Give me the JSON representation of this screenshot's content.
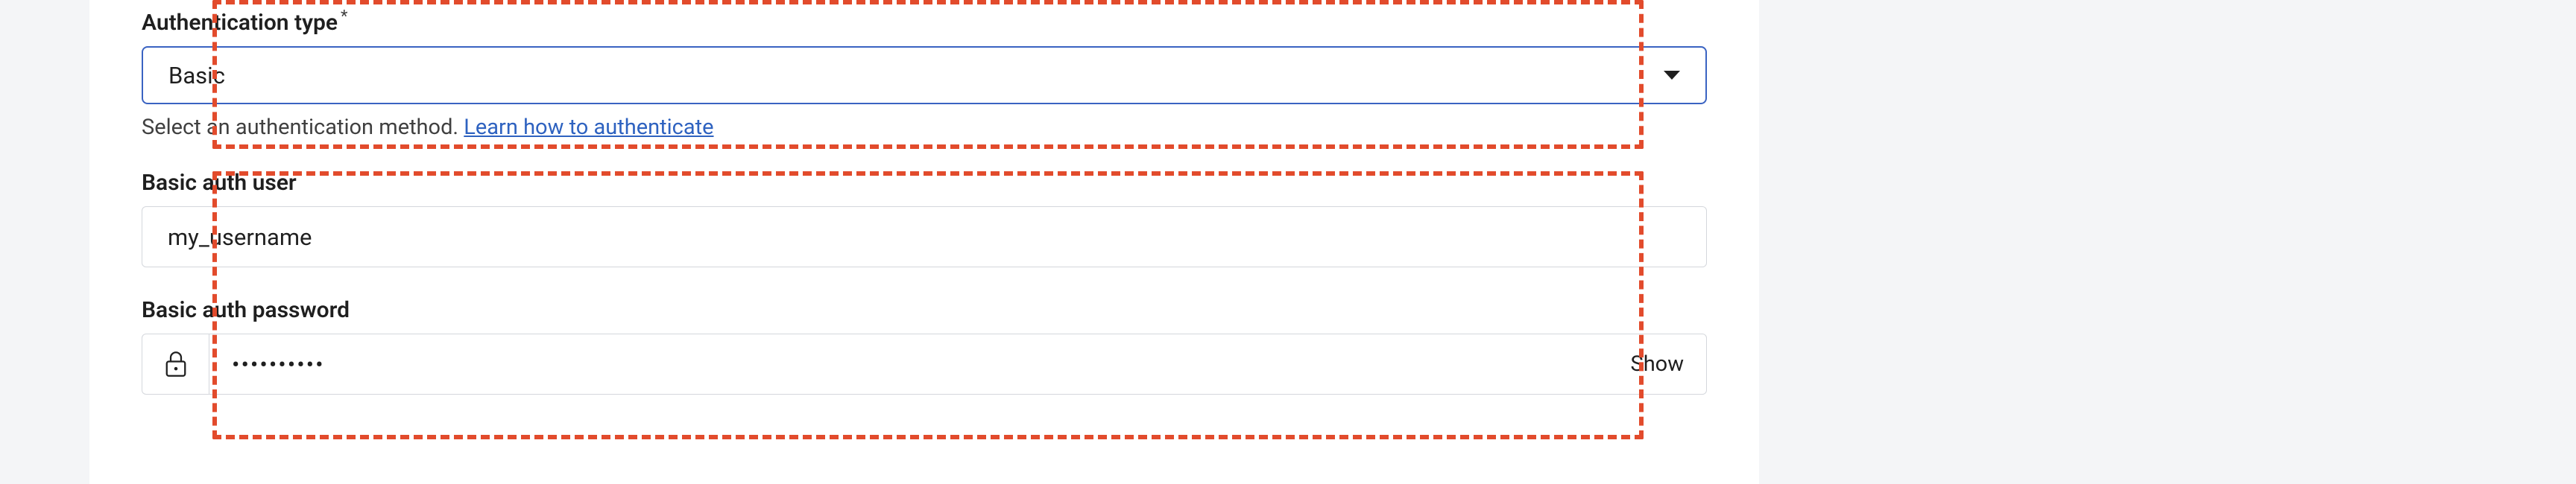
{
  "auth_type": {
    "label": "Authentication type",
    "required_mark": "*",
    "value": "Basic",
    "helper_text": "Select an authentication method. ",
    "helper_link": "Learn how to authenticate"
  },
  "basic_user": {
    "label": "Basic auth user",
    "value": "my_username"
  },
  "basic_password": {
    "label": "Basic auth password",
    "value": "••••••••••",
    "show_label": "Show"
  }
}
